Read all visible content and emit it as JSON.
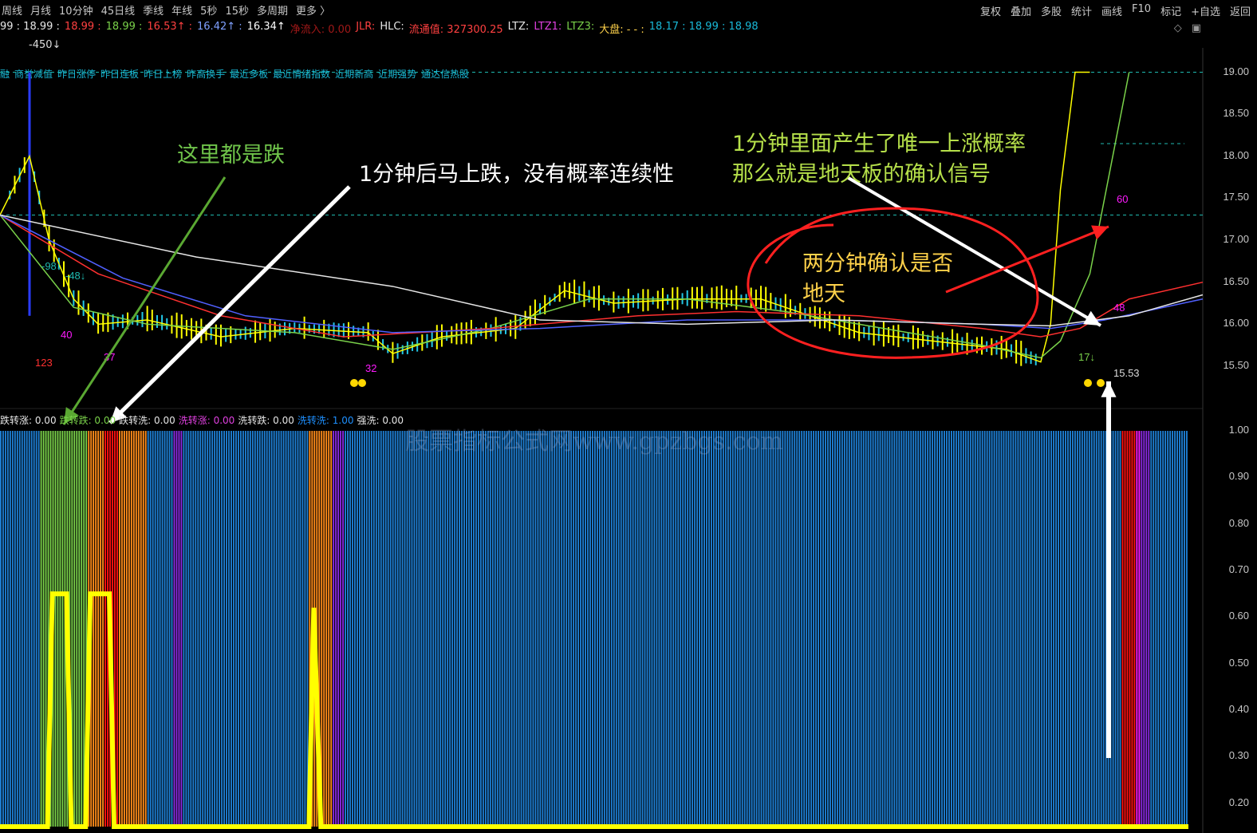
{
  "topbar": {
    "periods": [
      "周线",
      "月线",
      "10分钟",
      "45日线",
      "季线",
      "年线",
      "5秒",
      "15秒",
      "多周期",
      "更多 〉"
    ],
    "tools": [
      "复权",
      "叠加",
      "多股",
      "统计",
      "画线",
      "F10",
      "标记",
      "+自选",
      "返回"
    ]
  },
  "infobar": [
    {
      "text": "99 : 18.99 :",
      "color": "#e6e6e6"
    },
    {
      "text": "18.99 :",
      "color": "#ff4040"
    },
    {
      "text": "18.99 :",
      "color": "#7ad24a"
    },
    {
      "text": "16.53↑ :",
      "color": "#ff4040"
    },
    {
      "text": "16.42↑ :",
      "color": "#7fa0ff"
    },
    {
      "text": "16.34↑",
      "color": "#ffffff"
    },
    {
      "text": "净流入: 0.00",
      "color": "#a01818"
    },
    {
      "text": "JLR:",
      "color": "#ff4040"
    },
    {
      "text": "HLC:",
      "color": "#e6e6e6"
    },
    {
      "text": "流通值: 327300.25",
      "color": "#ff4040"
    },
    {
      "text": "LTZ:",
      "color": "#e6e6e6"
    },
    {
      "text": "LTZ1:",
      "color": "#e040e0"
    },
    {
      "text": "LTZ3:",
      "color": "#7ad24a"
    },
    {
      "text": "大盘: - - :",
      "color": "#ffd24a"
    },
    {
      "text": "18.17 : 18.99 : 18.98",
      "color": "#19b9d8"
    }
  ],
  "vol_label": "-450↓",
  "toolbar_icons": [
    "diamond-icon",
    "window-icon"
  ],
  "tabs": [
    "融",
    "商誉减值",
    "昨日涨停",
    "昨日连板",
    "昨日上榜",
    "昨高换手",
    "最近多板",
    "最近情绪指数",
    "近期新高",
    "近期强势",
    "通达信热股"
  ],
  "lower_legend": [
    {
      "text": "跌转涨: 0.00",
      "color": "#e6e6e6"
    },
    {
      "text": "跌转跌: 0.00",
      "color": "#7ad24a"
    },
    {
      "text": "跌转洗: 0.00",
      "color": "#e6e6e6"
    },
    {
      "text": "洗转涨: 0.00",
      "color": "#e040e0"
    },
    {
      "text": "洗转跌: 0.00",
      "color": "#e6e6e6"
    },
    {
      "text": "洗转洗: 1.00",
      "color": "#1e90ff"
    },
    {
      "text": "强洗: 0.00",
      "color": "#e6e6e6"
    }
  ],
  "price_axis": [
    "19.00",
    "18.50",
    "18.00",
    "17.50",
    "17.00",
    "16.50",
    "16.00",
    "15.50"
  ],
  "prob_axis": [
    "1.00",
    "0.90",
    "0.80",
    "0.70",
    "0.60",
    "0.50",
    "0.40",
    "0.30",
    "0.20"
  ],
  "price_marks": [
    "123",
    "-98↓",
    "-48↓",
    "40",
    "37",
    "32",
    "60",
    "48",
    "17↓",
    "15.53"
  ],
  "annotations": {
    "all_down": "这里都是跌",
    "after_1min": "1分钟后马上跌，没有概率连续性",
    "signal_line1": "1分钟里面产生了唯一上涨概率",
    "signal_line2": "那么就是地天板的确认信号",
    "confirm_line1": "两分钟确认是否",
    "confirm_line2": "地天"
  },
  "watermark": "股票指标公式网www.gpzbgs.com",
  "colors": {
    "background": "#000000",
    "blue_bar": "#1e7fd4",
    "red": "#ff1010",
    "yellow": "#ffff00",
    "green": "#7ad24a",
    "orange": "#ff8c1a",
    "purple": "#8a2be2",
    "magenta": "#ff1aff",
    "annotation_green": "#7ad24a",
    "annotation_white": "#ffffff",
    "annotation_yellow": "#ffd24a"
  },
  "chart_data": [
    {
      "type": "line",
      "description_axis": "price",
      "ylim": [
        15.3,
        19.1
      ],
      "yticks": [
        19.0,
        18.5,
        18.0,
        17.5,
        17.0,
        16.5,
        16.0,
        15.5
      ],
      "minutes": 245,
      "series": [
        {
          "color": "#ffff00",
          "points": [
            [
              0,
              17.3
            ],
            [
              6,
              18.0
            ],
            [
              10,
              17.0
            ],
            [
              15,
              16.3
            ],
            [
              20,
              16.0
            ],
            [
              30,
              16.05
            ],
            [
              45,
              15.85
            ],
            [
              60,
              15.95
            ],
            [
              75,
              15.9
            ],
            [
              80,
              15.65
            ],
            [
              90,
              15.85
            ],
            [
              105,
              15.95
            ],
            [
              115,
              16.4
            ],
            [
              125,
              16.25
            ],
            [
              140,
              16.3
            ],
            [
              155,
              16.3
            ],
            [
              165,
              16.1
            ],
            [
              175,
              15.9
            ],
            [
              190,
              15.8
            ],
            [
              205,
              15.7
            ],
            [
              212,
              15.55
            ],
            [
              214,
              16.0
            ],
            [
              216,
              17.6
            ],
            [
              219,
              19.0
            ],
            [
              222,
              19.0
            ]
          ]
        },
        {
          "color": "#7ad24a",
          "points": [
            [
              0,
              17.3
            ],
            [
              15,
              16.2
            ],
            [
              30,
              16.0
            ],
            [
              60,
              15.9
            ],
            [
              80,
              15.7
            ],
            [
              100,
              15.95
            ],
            [
              120,
              16.3
            ],
            [
              140,
              16.3
            ],
            [
              160,
              16.15
            ],
            [
              180,
              15.95
            ],
            [
              200,
              15.75
            ],
            [
              212,
              15.6
            ],
            [
              216,
              15.8
            ],
            [
              222,
              16.6
            ],
            [
              230,
              19.0
            ]
          ]
        },
        {
          "color": "#ff3030",
          "points": [
            [
              0,
              17.3
            ],
            [
              20,
              16.6
            ],
            [
              45,
              16.1
            ],
            [
              70,
              15.85
            ],
            [
              100,
              15.95
            ],
            [
              130,
              16.1
            ],
            [
              150,
              16.15
            ],
            [
              175,
              16.1
            ],
            [
              200,
              15.95
            ],
            [
              212,
              15.85
            ],
            [
              220,
              15.95
            ],
            [
              230,
              16.3
            ],
            [
              245,
              16.5
            ]
          ]
        },
        {
          "color": "#5060ff",
          "points": [
            [
              0,
              17.3
            ],
            [
              25,
              16.55
            ],
            [
              50,
              16.1
            ],
            [
              80,
              15.9
            ],
            [
              110,
              15.95
            ],
            [
              140,
              16.05
            ],
            [
              170,
              16.05
            ],
            [
              200,
              16.0
            ],
            [
              214,
              15.95
            ],
            [
              225,
              16.05
            ],
            [
              245,
              16.3
            ]
          ]
        },
        {
          "color": "#e6e6e6",
          "points": [
            [
              0,
              17.3
            ],
            [
              40,
              16.8
            ],
            [
              80,
              16.45
            ],
            [
              110,
              16.05
            ],
            [
              140,
              16.0
            ],
            [
              170,
              16.05
            ],
            [
              200,
              16.0
            ],
            [
              214,
              15.98
            ],
            [
              230,
              16.1
            ],
            [
              245,
              16.35
            ]
          ]
        }
      ],
      "reference_lines": [
        17.3,
        19.0,
        18.15
      ]
    },
    {
      "type": "bar",
      "description_axis": "probability",
      "ylim": [
        0.15,
        1.0
      ],
      "yticks": [
        1.0,
        0.9,
        0.8,
        0.7,
        0.6,
        0.5,
        0.4,
        0.3,
        0.2
      ],
      "segments": [
        {
          "from": 0,
          "to": 17,
          "color": "#1e7fd4",
          "value": 1.0
        },
        {
          "from": 17,
          "to": 37,
          "color": "#7ad24a",
          "value": 1.0
        },
        {
          "from": 37,
          "to": 44,
          "color": "#ff8c1a",
          "value": 1.0
        },
        {
          "from": 44,
          "to": 50,
          "color": "#ff1010",
          "value": 1.0
        },
        {
          "from": 50,
          "to": 62,
          "color": "#ff8c1a",
          "value": 1.0
        },
        {
          "from": 62,
          "to": 73,
          "color": "#1e7fd4",
          "value": 1.0
        },
        {
          "from": 73,
          "to": 77,
          "color": "#8a2be2",
          "value": 1.0
        },
        {
          "from": 77,
          "to": 130,
          "color": "#1e7fd4",
          "value": 1.0
        },
        {
          "from": 130,
          "to": 140,
          "color": "#ff8c1a",
          "value": 1.0
        },
        {
          "from": 140,
          "to": 145,
          "color": "#8a2be2",
          "value": 1.0
        },
        {
          "from": 145,
          "to": 472,
          "color": "#1e7fd4",
          "value": 1.0
        },
        {
          "from": 472,
          "to": 478,
          "color": "#ff1010",
          "value": 1.0
        },
        {
          "from": 478,
          "to": 480,
          "color": "#ff1aff",
          "value": 1.0
        },
        {
          "from": 480,
          "to": 484,
          "color": "#8a2be2",
          "value": 1.0
        },
        {
          "from": 484,
          "to": 500,
          "color": "#1e7fd4",
          "value": 1.0
        }
      ],
      "yellow_line": [
        [
          0,
          0.15
        ],
        [
          20,
          0.15
        ],
        [
          22,
          0.65
        ],
        [
          28,
          0.65
        ],
        [
          30,
          0.15
        ],
        [
          36,
          0.15
        ],
        [
          38,
          0.65
        ],
        [
          46,
          0.65
        ],
        [
          48,
          0.15
        ],
        [
          60,
          0.15
        ],
        [
          130,
          0.15
        ],
        [
          132,
          0.62
        ],
        [
          135,
          0.15
        ],
        [
          500,
          0.15
        ]
      ]
    }
  ]
}
